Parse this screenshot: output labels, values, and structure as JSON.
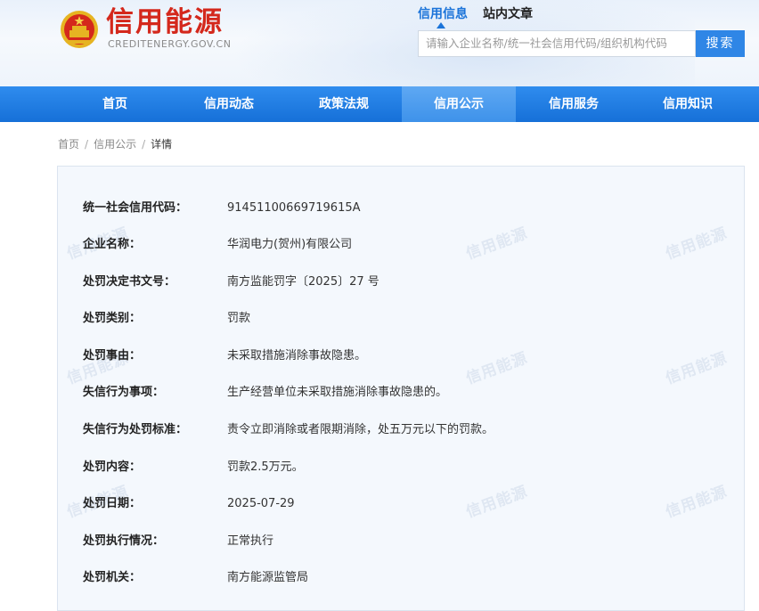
{
  "site": {
    "title": "信用能源",
    "subtitle": "CREDITENERGY.GOV.CN"
  },
  "search": {
    "tabs": [
      {
        "label": "信用信息"
      },
      {
        "label": "站内文章"
      }
    ],
    "placeholder": "请输入企业名称/统一社会信用代码/组织机构代码",
    "button": "搜索"
  },
  "nav": [
    {
      "label": "首页"
    },
    {
      "label": "信用动态"
    },
    {
      "label": "政策法规"
    },
    {
      "label": "信用公示",
      "active": true
    },
    {
      "label": "信用服务"
    },
    {
      "label": "信用知识"
    }
  ],
  "breadcrumb": [
    "首页",
    "信用公示",
    "详情"
  ],
  "watermark": "信用能源",
  "details": [
    {
      "label": "统一社会信用代码：",
      "value": "91451100669719615A"
    },
    {
      "label": "企业名称：",
      "value": "华润电力(贺州)有限公司"
    },
    {
      "label": "处罚决定书文号：",
      "value": "南方监能罚字〔2025〕27 号"
    },
    {
      "label": "处罚类别：",
      "value": "罚款"
    },
    {
      "label": "处罚事由：",
      "value": "未采取措施消除事故隐患。"
    },
    {
      "label": "失信行为事项：",
      "value": "生产经营单位未采取措施消除事故隐患的。"
    },
    {
      "label": "失信行为处罚标准：",
      "value": "责令立即消除或者限期消除，处五万元以下的罚款。"
    },
    {
      "label": "处罚内容：",
      "value": "罚款2.5万元。"
    },
    {
      "label": "处罚日期：",
      "value": "2025-07-29"
    },
    {
      "label": "处罚执行情况：",
      "value": "正常执行"
    },
    {
      "label": "处罚机关：",
      "value": "南方能源监管局"
    }
  ],
  "colors": {
    "brand_red": "#d4281c",
    "nav_blue": "#1a73d9",
    "accent_blue": "#2f86e6"
  }
}
